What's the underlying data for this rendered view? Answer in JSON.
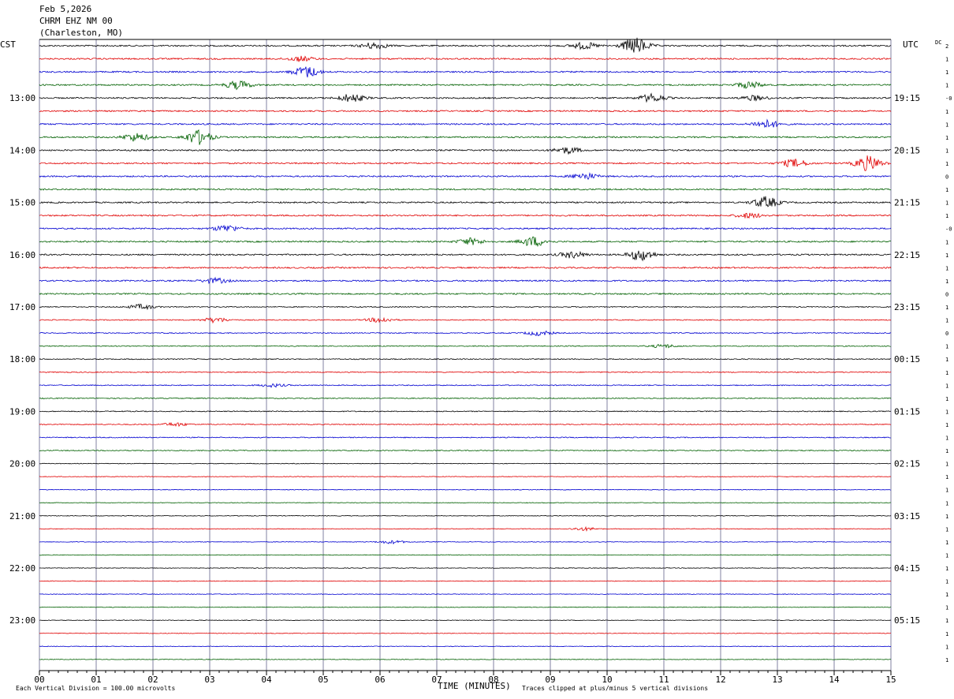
{
  "header": {
    "date": "Feb 5,2026",
    "station": "CHRM EHZ NM 00",
    "location": "(Charleston, MO)"
  },
  "left_timezone": "CST",
  "right_timezone": "UTC",
  "dc_label": "DC",
  "footer": {
    "scale_note": "Each Vertical Division =  100.00 microvolts",
    "xlabel": "TIME (MINUTES)",
    "clip_note": "Traces clipped at plus/minus 5 vertical divisions"
  },
  "colors": {
    "trace_cycle": [
      "#000000",
      "#e00000",
      "#0000d0",
      "#006000"
    ],
    "grid": "#8080a0",
    "background": "#ffffff"
  },
  "chart_data": {
    "type": "line",
    "subtype": "helicorder",
    "x_ticks": [
      "00",
      "01",
      "02",
      "03",
      "04",
      "05",
      "06",
      "07",
      "08",
      "09",
      "10",
      "11",
      "12",
      "13",
      "14",
      "15"
    ],
    "xlim": [
      0,
      15
    ],
    "trace_count": 48,
    "left_hour_labels": [
      "13:00",
      "14:00",
      "15:00",
      "16:00",
      "17:00",
      "18:00",
      "19:00",
      "20:00",
      "21:00",
      "22:00",
      "23:00"
    ],
    "right_hour_labels": [
      "19:15",
      "20:15",
      "21:15",
      "22:15",
      "23:15",
      "00:15",
      "01:15",
      "02:15",
      "03:15",
      "04:15",
      "05:15"
    ],
    "dc_offsets": [
      "2",
      "1",
      "1",
      "1",
      "-0",
      "1",
      "1",
      "1",
      "1",
      "1",
      "0",
      "1",
      "1",
      "1",
      "-0",
      "1",
      "1",
      "1",
      "1",
      "0",
      "1",
      "1",
      "0",
      "1",
      "1",
      "1",
      "1",
      "1",
      "1",
      "1",
      "1",
      "1",
      "1",
      "1",
      "1",
      "1",
      "1",
      "1",
      "1",
      "1",
      "1",
      "1",
      "1",
      "1",
      "1",
      "1",
      "1",
      "1"
    ],
    "events": [
      {
        "trace": 0,
        "minute": 5.9,
        "amp": 4
      },
      {
        "trace": 0,
        "minute": 10.5,
        "amp": 10
      },
      {
        "trace": 0,
        "minute": 9.6,
        "amp": 4
      },
      {
        "trace": 1,
        "minute": 4.6,
        "amp": 3
      },
      {
        "trace": 2,
        "minute": 4.7,
        "amp": 7
      },
      {
        "trace": 3,
        "minute": 3.5,
        "amp": 5
      },
      {
        "trace": 3,
        "minute": 12.5,
        "amp": 4
      },
      {
        "trace": 4,
        "minute": 5.5,
        "amp": 5
      },
      {
        "trace": 4,
        "minute": 10.8,
        "amp": 5
      },
      {
        "trace": 4,
        "minute": 12.6,
        "amp": 3
      },
      {
        "trace": 6,
        "minute": 12.8,
        "amp": 5
      },
      {
        "trace": 7,
        "minute": 1.7,
        "amp": 5
      },
      {
        "trace": 7,
        "minute": 2.8,
        "amp": 9
      },
      {
        "trace": 8,
        "minute": 9.3,
        "amp": 4
      },
      {
        "trace": 9,
        "minute": 13.3,
        "amp": 5
      },
      {
        "trace": 9,
        "minute": 14.6,
        "amp": 9
      },
      {
        "trace": 10,
        "minute": 9.6,
        "amp": 4
      },
      {
        "trace": 12,
        "minute": 12.8,
        "amp": 7
      },
      {
        "trace": 13,
        "minute": 12.5,
        "amp": 3
      },
      {
        "trace": 14,
        "minute": 3.3,
        "amp": 4
      },
      {
        "trace": 15,
        "minute": 7.6,
        "amp": 4
      },
      {
        "trace": 15,
        "minute": 8.7,
        "amp": 6
      },
      {
        "trace": 16,
        "minute": 9.4,
        "amp": 4
      },
      {
        "trace": 16,
        "minute": 10.6,
        "amp": 7
      },
      {
        "trace": 18,
        "minute": 3.1,
        "amp": 3
      },
      {
        "trace": 20,
        "minute": 1.8,
        "amp": 3
      },
      {
        "trace": 21,
        "minute": 3.1,
        "amp": 3
      },
      {
        "trace": 21,
        "minute": 6.0,
        "amp": 3
      },
      {
        "trace": 22,
        "minute": 8.8,
        "amp": 3
      },
      {
        "trace": 23,
        "minute": 11.0,
        "amp": 2
      },
      {
        "trace": 26,
        "minute": 4.1,
        "amp": 2
      },
      {
        "trace": 29,
        "minute": 2.4,
        "amp": 2
      },
      {
        "trace": 37,
        "minute": 9.6,
        "amp": 2
      },
      {
        "trace": 38,
        "minute": 6.2,
        "amp": 2
      }
    ]
  }
}
